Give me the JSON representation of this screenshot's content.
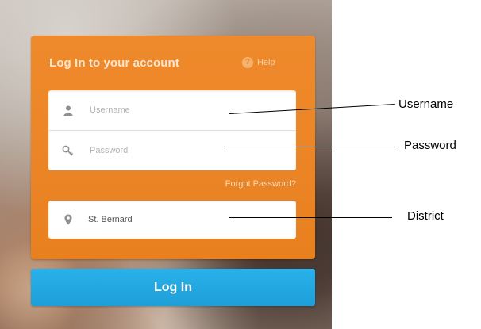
{
  "login_card": {
    "title": "Log In to your account",
    "help_label": "Help",
    "username_placeholder": "Username",
    "password_placeholder": "Password",
    "forgot_password": "Forgot Password?",
    "district_value": "St. Bernard",
    "login_button": "Log In"
  },
  "callouts": {
    "username": "Username",
    "password": "Password",
    "district": "District"
  },
  "colors": {
    "card_orange": "#ef8a2c",
    "button_blue": "#2ab1ea",
    "field_white": "#ffffff"
  },
  "icons": [
    "user-icon",
    "key-icon",
    "location-pin-icon",
    "help-icon"
  ]
}
